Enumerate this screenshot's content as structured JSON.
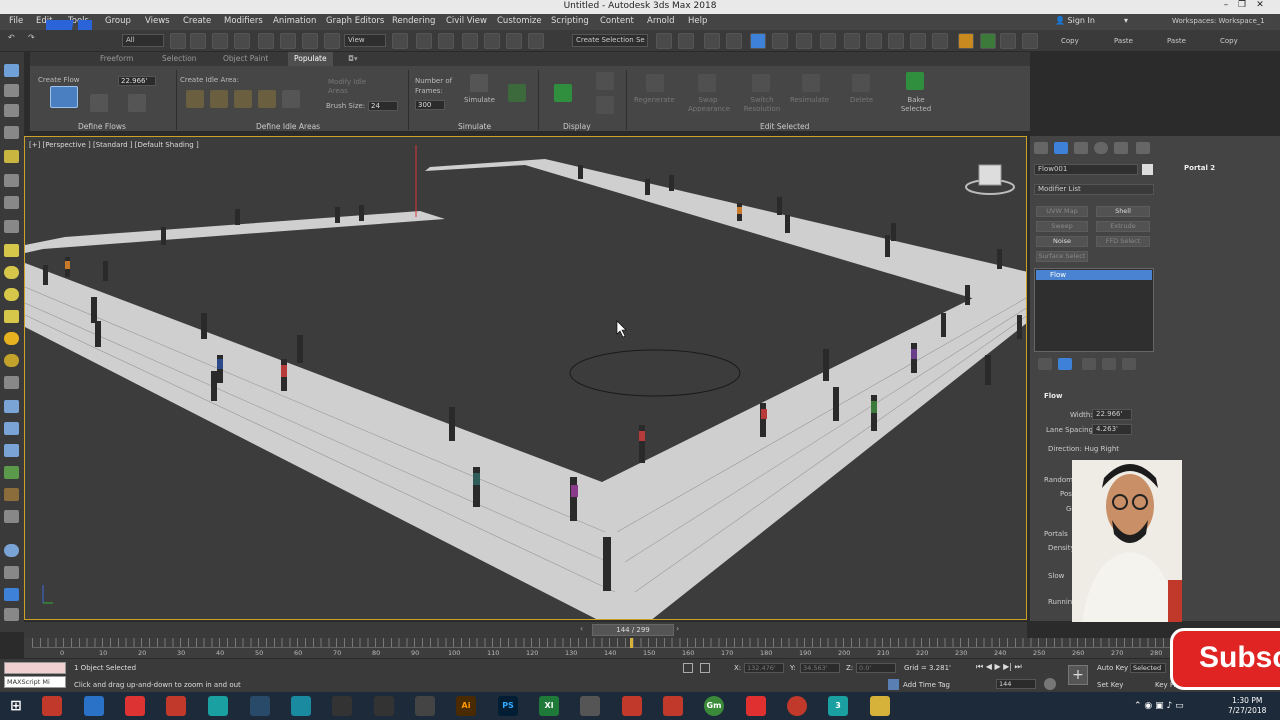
{
  "window": {
    "title": "Untitled - Autodesk 3ds Max 2018"
  },
  "menu": [
    "File",
    "Edit",
    "Tools",
    "Group",
    "Views",
    "Create",
    "Modifiers",
    "Animation",
    "Graph Editors",
    "Rendering",
    "Civil View",
    "Customize",
    "Scripting",
    "Content",
    "Arnold",
    "Help"
  ],
  "account": {
    "signin": "Sign In",
    "workspace_label": "Workspaces:",
    "workspace_value": "Workspace_1"
  },
  "toolbar": {
    "filter": "All",
    "refcoord": "View",
    "selection_set": "Create Selection Se",
    "copy1": "Copy",
    "paste1": "Paste",
    "paste2": "Paste",
    "copy2": "Copy"
  },
  "ribbon": {
    "tabs": [
      "Freeform",
      "Selection",
      "Object Paint",
      "Populate"
    ],
    "active_tab": "Populate",
    "create_flow": "Create Flow",
    "flow_width": "22.966'",
    "create_idle_area": "Create Idle Area:",
    "modify_idle_areas": "Modify Idle Areas",
    "brush_size_label": "Brush Size:",
    "brush_size": "24",
    "number_of_frames_label": "Number of Frames:",
    "number_of_frames": "300",
    "simulate": "Simulate",
    "regenerate": "Regenerate",
    "swap_appearance": "Swap Appearance",
    "switch_resolution": "Switch Resolution",
    "resimulate": "Resimulate",
    "delete": "Delete",
    "bake_selected": "Bake Selected",
    "sections": [
      "Define Flows",
      "Define Idle Areas",
      "Simulate",
      "Display",
      "Edit Selected"
    ]
  },
  "viewport": {
    "label": "[+] [Perspective ] [Standard ] [Default Shading ]"
  },
  "command_panel": {
    "object_name": "Flow001",
    "modifier_list": "Modifier List",
    "buttons": [
      {
        "label": "UVW Map",
        "on": false
      },
      {
        "label": "Shell",
        "on": true
      },
      {
        "label": "Sweep",
        "on": false
      },
      {
        "label": "Extrude",
        "on": false
      },
      {
        "label": "Noise",
        "on": true
      },
      {
        "label": "FFD Select",
        "on": false
      },
      {
        "label": "Surface Select",
        "on": false
      }
    ],
    "stack_item": "Flow",
    "portal": "Portal 2",
    "rollout_title": "Flow",
    "width_label": "Width:",
    "width_value": "22.966'",
    "lane_spacing_label": "Lane Spacing:",
    "lane_spacing_value": "4.263'",
    "direction_label": "Direction: Hug Right",
    "randomization": "Randomization",
    "positions": "Positions:",
    "gender": "Gender:",
    "portals": "Portals",
    "density": "Density",
    "slow": "Slow",
    "running": "Running"
  },
  "timeline": {
    "frame": "144 / 299",
    "ticks": [
      "0",
      "10",
      "20",
      "30",
      "40",
      "50",
      "60",
      "70",
      "80",
      "90",
      "100",
      "110",
      "120",
      "130",
      "140",
      "150",
      "160",
      "170",
      "180",
      "190",
      "200",
      "210",
      "220",
      "230",
      "240",
      "250",
      "260",
      "270",
      "280"
    ]
  },
  "status": {
    "maxscript": "MAXScript Mi",
    "selected": "1 Object Selected",
    "prompt": "Click and drag up-and-down to zoom in and out",
    "x_label": "X:",
    "x_value": "132.476'",
    "y_label": "Y:",
    "y_value": "34.563'",
    "z_label": "Z:",
    "z_value": "0.0'",
    "grid": "Grid = 3.281'",
    "add_time_tag": "Add Time Tag",
    "auto_key": "Auto Key",
    "selected_key": "Selected",
    "set_key": "Set Key",
    "key_filters": "Key Filters...",
    "frame_field": "144"
  },
  "overlay": {
    "subscribe": "Subsc"
  },
  "taskbar": {
    "time": "1:30 PM",
    "date": "7/27/2018",
    "apps": [
      "3ds",
      "PS",
      "Ai",
      "Xl",
      "Gm",
      "3"
    ]
  }
}
